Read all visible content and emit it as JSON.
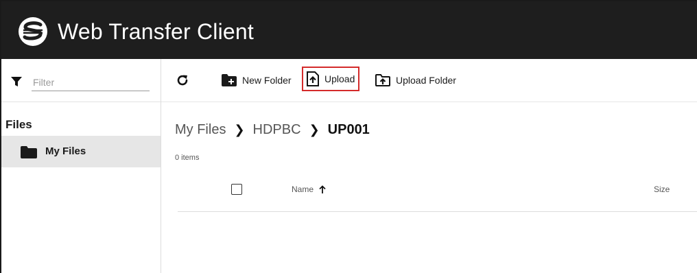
{
  "app": {
    "title": "Web Transfer Client"
  },
  "sidebar": {
    "filter_placeholder": "Filter",
    "section_heading": "Files",
    "items": [
      {
        "label": "My Files",
        "icon": "folder-icon",
        "selected": true
      }
    ]
  },
  "toolbar": {
    "refresh_icon": "refresh-icon",
    "new_folder_label": "New Folder",
    "upload_label": "Upload",
    "upload_folder_label": "Upload Folder",
    "highlight_color": "#d42a2a"
  },
  "breadcrumb": {
    "items": [
      "My Files",
      "HDPBC",
      "UP001"
    ]
  },
  "listing": {
    "item_count": "0 items",
    "columns": {
      "name": "Name",
      "size": "Size"
    },
    "sort_icon": "arrow-up-icon",
    "rows": []
  },
  "colors": {
    "header_bg": "#1e1e1e",
    "sidebar_selected_bg": "#e6e6e6"
  }
}
